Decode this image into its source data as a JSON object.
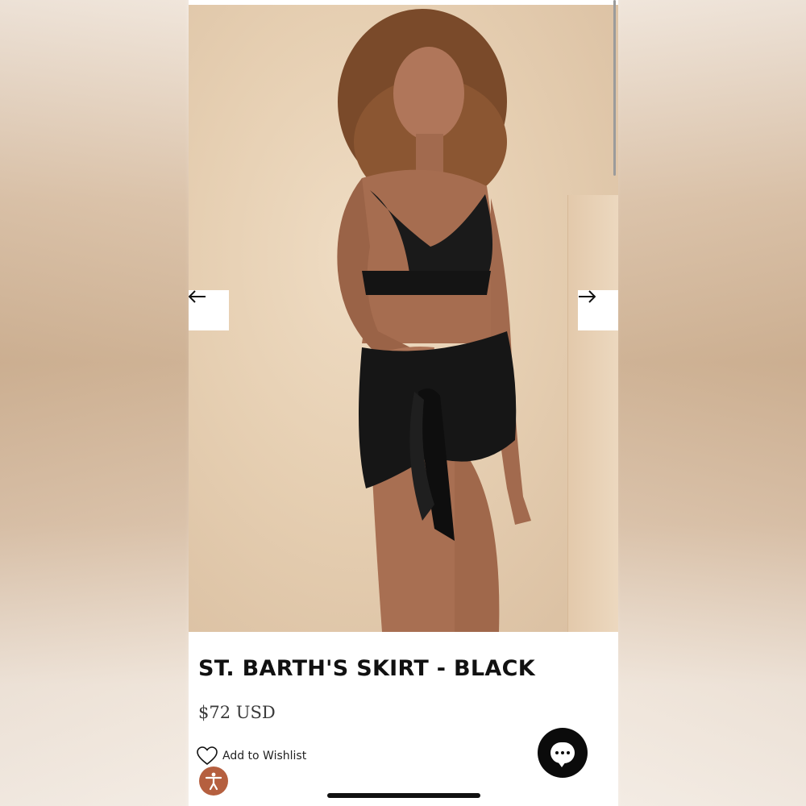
{
  "product": {
    "title": "ST. BARTH'S SKIRT - BLACK",
    "price": "$72 USD"
  },
  "actions": {
    "wishlist_label": "Add to Wishlist"
  },
  "icons": {
    "prev": "arrow-left-icon",
    "next": "arrow-right-icon",
    "wishlist": "heart-icon",
    "chat": "chat-bubble-icon",
    "accessibility": "accessibility-person-icon"
  },
  "colors": {
    "accessibility_button": "#b55f3f",
    "chat_button": "#0b0b0b",
    "title_text": "#111111"
  }
}
